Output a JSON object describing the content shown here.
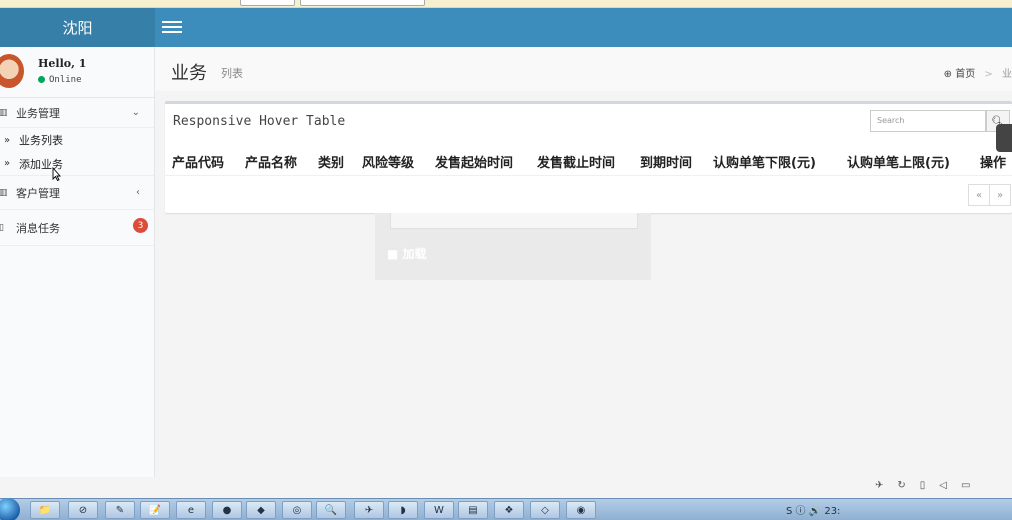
{
  "header": {
    "city": "沈阳"
  },
  "user": {
    "greeting": "Hello, 1",
    "status": "Online"
  },
  "sidebar": {
    "menus": [
      {
        "label": "业务管理",
        "expanded": true,
        "items": [
          {
            "label": "业务列表"
          },
          {
            "label": "添加业务"
          }
        ]
      },
      {
        "label": "客户管理",
        "expanded": false
      },
      {
        "label": "消息任务",
        "badge": "3"
      }
    ]
  },
  "page": {
    "title": "业务",
    "subtitle": "列表",
    "breadcrumb": {
      "home": "首页",
      "current": "业务"
    }
  },
  "panel": {
    "title": "Responsive Hover Table",
    "search_placeholder": "Search",
    "columns": [
      "产品代码",
      "产品名称",
      "类别",
      "风险等级",
      "发售起始时间",
      "发售截止时间",
      "到期时间",
      "认购单笔下限(元)",
      "认购单笔上限(元)",
      "操作"
    ],
    "pager": {
      "prev": "«",
      "next": "»"
    }
  },
  "overlay": {
    "text": "■ 加载"
  },
  "taskbar": {
    "tray_text": "S ⓘ 🔊 23:",
    "buttons": [
      "📁",
      "⊘",
      "✎",
      "📝",
      "e",
      "●",
      "◆",
      "◎",
      "🔍",
      "✈",
      "◗",
      "W",
      "▤",
      "❖",
      "◇",
      "◉"
    ]
  },
  "colors": {
    "header": "#3c8dbc",
    "logo": "#367fa9",
    "badge": "#dd4b39",
    "online": "#00a65a"
  }
}
